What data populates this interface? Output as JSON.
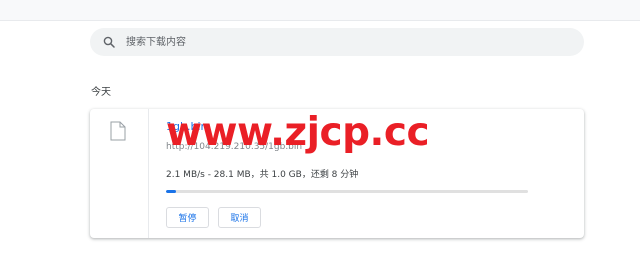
{
  "search": {
    "placeholder": "搜索下载内容",
    "icon": "search-icon"
  },
  "sections": [
    {
      "label": "今天",
      "items": [
        {
          "file_icon": "file-icon",
          "name": "1gb.bin",
          "url": "http://104.219.210.35/1gb.bin",
          "status": "2.1 MB/s - 28.1 MB，共 1.0 GB，还剩 8 分钟",
          "progress_fraction": 0.0275,
          "buttons": {
            "pause": "暂停",
            "cancel": "取消"
          }
        }
      ]
    }
  ],
  "watermark": "www.zjcp.cc",
  "colors": {
    "accent": "#1a73e8",
    "watermark": "#ea1f26",
    "search_bg": "#f1f3f4"
  }
}
